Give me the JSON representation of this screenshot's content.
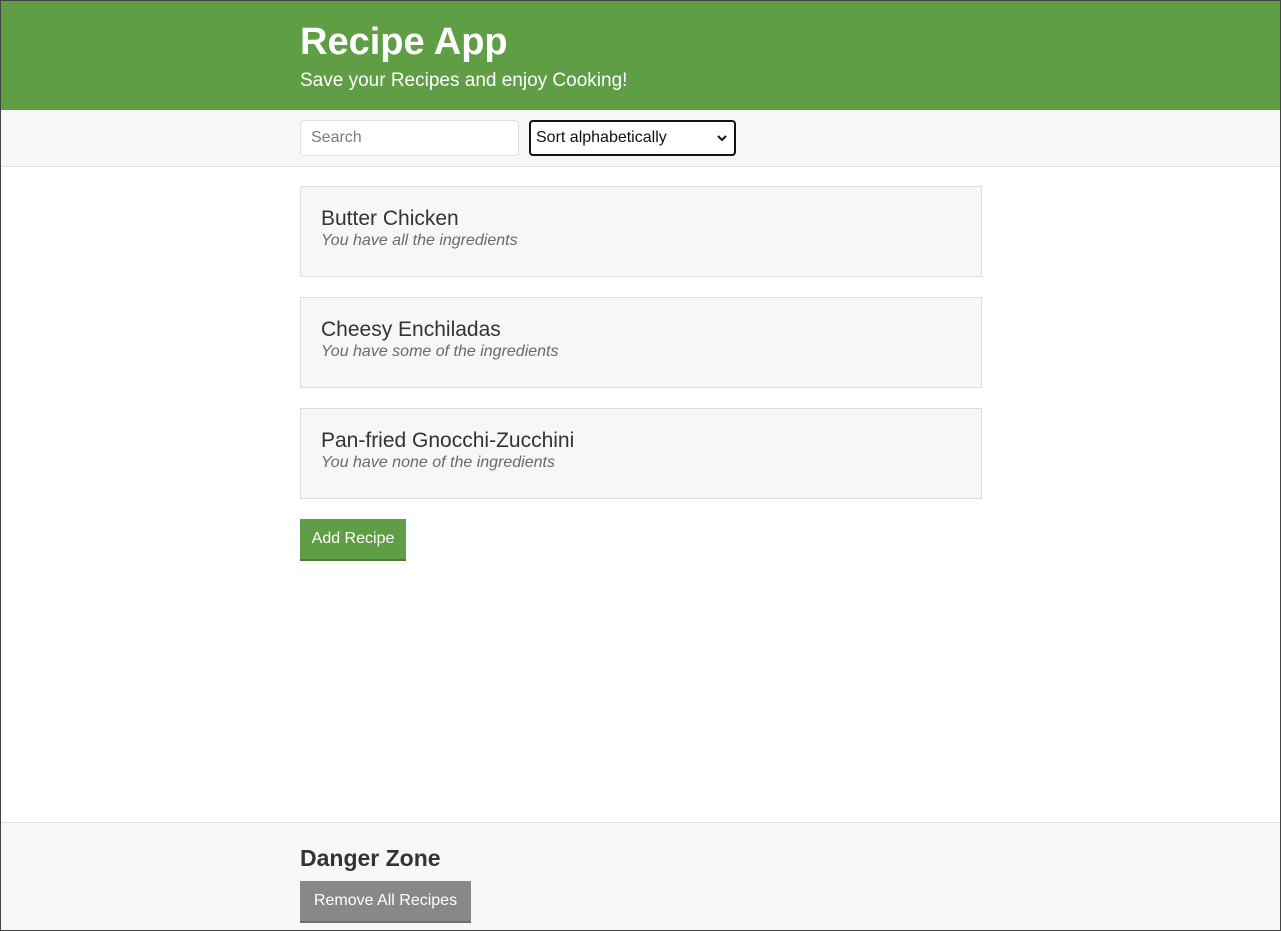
{
  "header": {
    "title": "Recipe App",
    "subtitle": "Save your Recipes and enjoy Cooking!"
  },
  "toolbar": {
    "search_placeholder": "Search",
    "search_value": "",
    "sort_selected": "Sort alphabetically"
  },
  "recipes": [
    {
      "name": "Butter Chicken",
      "status": "You have all the ingredients"
    },
    {
      "name": "Cheesy Enchiladas",
      "status": "You have some of the ingredients"
    },
    {
      "name": "Pan-fried Gnocchi-Zucchini",
      "status": "You have none of the ingredients"
    }
  ],
  "actions": {
    "add_label": "Add Recipe"
  },
  "danger": {
    "title": "Danger Zone",
    "remove_label": "Remove All Recipes"
  },
  "colors": {
    "brand": "#609e45",
    "panel": "#f7f7f7",
    "border": "#dedede",
    "danger_button": "#888888"
  }
}
